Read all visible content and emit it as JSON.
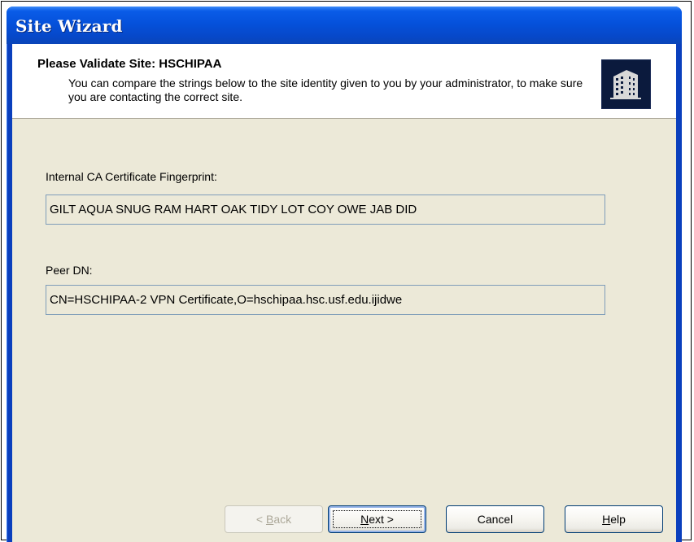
{
  "window": {
    "title": "Site Wizard"
  },
  "header": {
    "title": "Please Validate Site: HSCHIPAA",
    "description": "You can compare the strings below to the site identity given to you by your administrator, to make sure you are contacting the correct site.",
    "logo_icon": "building-icon"
  },
  "fingerprint": {
    "label": "Internal CA Certificate Fingerprint:",
    "value": "GILT AQUA SNUG RAM HART OAK TIDY LOT COY OWE JAB DID"
  },
  "peer": {
    "label": "Peer DN:",
    "value": "CN=HSCHIPAA-2 VPN Certificate,O=hschipaa.hsc.usf.edu.ijidwe"
  },
  "buttons": {
    "back_pre": "< ",
    "back_key": "B",
    "back_post": "ack",
    "next_key": "N",
    "next_post": "ext >",
    "cancel": "Cancel",
    "help_key": "H",
    "help_post": "elp"
  },
  "colors": {
    "titlebar": "#0551db",
    "dialog_face": "#ece9d8",
    "field_border": "#7f9db9"
  }
}
